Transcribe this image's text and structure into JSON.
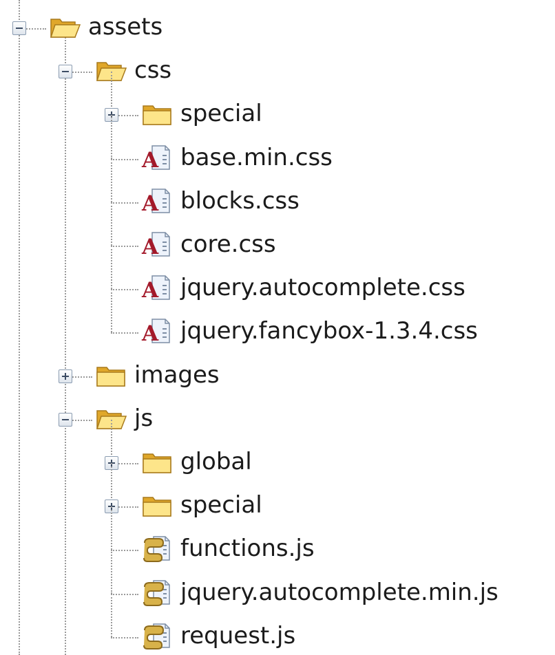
{
  "tree": [
    {
      "id": "assets",
      "label": "assets",
      "kind": "folder",
      "state": "expanded",
      "depth": 0,
      "icon": "folder-open-icon"
    },
    {
      "id": "css",
      "label": "css",
      "kind": "folder",
      "state": "expanded",
      "depth": 1,
      "icon": "folder-open-icon"
    },
    {
      "id": "css-special",
      "label": "special",
      "kind": "folder",
      "state": "collapsed",
      "depth": 2,
      "icon": "folder-icon"
    },
    {
      "id": "base-min-css",
      "label": "base.min.css",
      "kind": "css",
      "depth": 2,
      "icon": "css-file-icon"
    },
    {
      "id": "blocks-css",
      "label": "blocks.css",
      "kind": "css",
      "depth": 2,
      "icon": "css-file-icon"
    },
    {
      "id": "core-css",
      "label": "core.css",
      "kind": "css",
      "depth": 2,
      "icon": "css-file-icon"
    },
    {
      "id": "jquery-autocomplete-css",
      "label": "jquery.autocomplete.css",
      "kind": "css",
      "depth": 2,
      "icon": "css-file-icon"
    },
    {
      "id": "jquery-fancybox-css",
      "label": "jquery.fancybox-1.3.4.css",
      "kind": "css",
      "depth": 2,
      "icon": "css-file-icon"
    },
    {
      "id": "images",
      "label": "images",
      "kind": "folder",
      "state": "collapsed",
      "depth": 1,
      "icon": "folder-icon"
    },
    {
      "id": "js",
      "label": "js",
      "kind": "folder",
      "state": "expanded",
      "depth": 1,
      "icon": "folder-open-icon"
    },
    {
      "id": "global",
      "label": "global",
      "kind": "folder",
      "state": "collapsed",
      "depth": 2,
      "icon": "folder-icon"
    },
    {
      "id": "js-special",
      "label": "special",
      "kind": "folder",
      "state": "collapsed",
      "depth": 2,
      "icon": "folder-icon"
    },
    {
      "id": "functions-js",
      "label": "functions.js",
      "kind": "js",
      "depth": 2,
      "icon": "js-file-icon"
    },
    {
      "id": "jquery-autocomplete-min-js",
      "label": "jquery.autocomplete.min.js",
      "kind": "js",
      "depth": 2,
      "icon": "js-file-icon"
    },
    {
      "id": "request-js",
      "label": "request.js",
      "kind": "js",
      "depth": 2,
      "icon": "js-file-icon"
    }
  ],
  "colors": {
    "folder_light": "#fde58a",
    "folder_dark": "#e0a72a",
    "folder_edge": "#a87a1c",
    "css_letter": "#a3192a",
    "js_scroll": "#d8b24a",
    "file_page": "#eef3fb",
    "file_edge": "#7d8ea5"
  }
}
